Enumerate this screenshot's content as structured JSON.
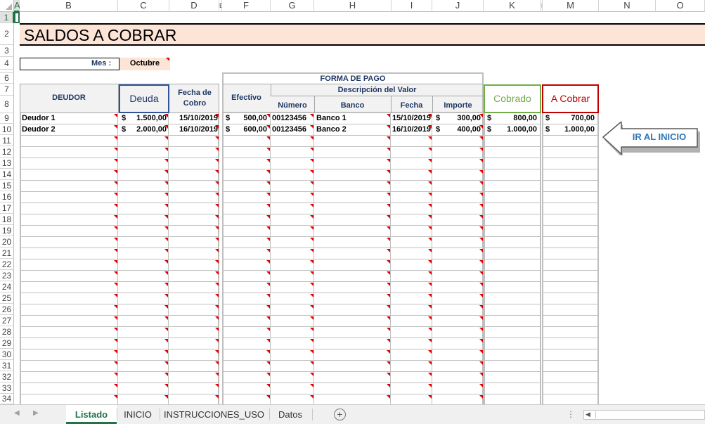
{
  "columns": [
    "A",
    "B",
    "C",
    "D",
    "E",
    "F",
    "G",
    "H",
    "I",
    "J",
    "K",
    "L",
    "M",
    "N",
    "O"
  ],
  "rows": [
    "1",
    "2",
    "3",
    "4",
    "5",
    "6",
    "7",
    "8",
    "9",
    "10",
    "11",
    "12",
    "13",
    "14",
    "15",
    "16",
    "17",
    "18",
    "19",
    "20",
    "21",
    "22",
    "23",
    "24",
    "25",
    "26",
    "27",
    "28",
    "29",
    "30",
    "31",
    "32",
    "33",
    "34"
  ],
  "title": "SALDOS A COBRAR",
  "mes_label": "Mes :",
  "mes_value": "Octubre",
  "headers": {
    "forma_de_pago": "FORMA DE PAGO",
    "descripcion_valor": "Descripción del Valor",
    "deudor": "DEUDOR",
    "deuda": "Deuda",
    "fecha_cobro": "Fecha de Cobro",
    "efectivo": "Efectivo",
    "numero": "Número",
    "banco": "Banco",
    "fecha": "Fecha",
    "importe": "Importe",
    "cobrado": "Cobrado",
    "a_cobrar": "A Cobrar"
  },
  "data_rows": [
    {
      "deudor": "Deudor 1",
      "deuda_cur": "$",
      "deuda": "1.500,00",
      "fecha_cobro": "15/10/2019",
      "efectivo_cur": "$",
      "efectivo": "500,00",
      "numero": "00123456",
      "banco": "Banco 1",
      "fecha": "15/10/2019",
      "importe_cur": "$",
      "importe": "300,00",
      "cobrado_cur": "$",
      "cobrado": "800,00",
      "a_cobrar_cur": "$",
      "a_cobrar": "700,00"
    },
    {
      "deudor": "Deudor 2",
      "deuda_cur": "$",
      "deuda": "2.000,00",
      "fecha_cobro": "16/10/2019",
      "efectivo_cur": "$",
      "efectivo": "600,00",
      "numero": "00123456",
      "banco": "Banco 2",
      "fecha": "16/10/2019",
      "importe_cur": "$",
      "importe": "400,00",
      "cobrado_cur": "$",
      "cobrado": "1.000,00",
      "a_cobrar_cur": "$",
      "a_cobrar": "1.000,00"
    }
  ],
  "button": {
    "label": "IR AL INICIO"
  },
  "sheet_tabs": [
    "Listado",
    "INICIO",
    "INSTRUCCIONES_USO",
    "Datos"
  ],
  "active_tab": "Listado",
  "colors": {
    "title_bg": "#fce4d6",
    "mes_bg": "#fce4d6",
    "header_bg": "#f2f2f2",
    "navy": "#1f3864",
    "deuda_border": "#2f5597",
    "cobrado": "#70ad47",
    "a_cobrar": "#c00000",
    "button_text": "#2e75b6",
    "active_tab": "#217346",
    "comment_marker": "#e00000"
  }
}
